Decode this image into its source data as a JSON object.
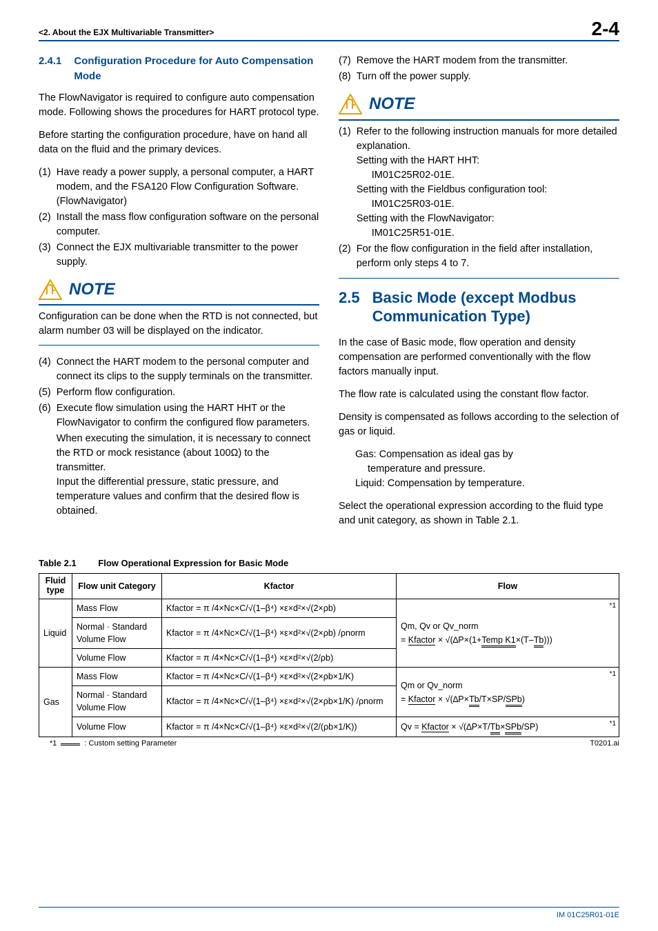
{
  "header": {
    "chapter": "<2.  About the EJX Multivariable Transmitter>",
    "page_number": "2-4"
  },
  "left": {
    "subheading_num": "2.4.1",
    "subheading_text": "Configuration Procedure for Auto Compensation Mode",
    "para1": "The FlowNavigator is required to configure auto compensation mode. Following shows the procedures for HART protocol type.",
    "para2": "Before starting the configuration procedure, have on hand all data on the fluid and the primary devices.",
    "steps_a": [
      {
        "n": "(1)",
        "t": "Have ready a power supply, a personal computer, a HART modem, and the FSA120 Flow Configuration Software. (FlowNavigator)"
      },
      {
        "n": "(2)",
        "t": "Install the mass flow configuration software on the personal computer."
      },
      {
        "n": "(3)",
        "t": "Connect the EJX multivariable transmitter to the power supply."
      }
    ],
    "note1_title": "NOTE",
    "note1_body": "Configuration can be done when the RTD is not connected, but alarm number 03 will be displayed on the indicator.",
    "steps_b": [
      {
        "n": "(4)",
        "t": "Connect the HART modem to the personal computer and connect its clips to the supply terminals on the transmitter."
      },
      {
        "n": "(5)",
        "t": "Perform flow configuration."
      },
      {
        "n": "(6)",
        "t": "Execute flow simulation using the HART HHT or the FlowNavigator to confirm the configured flow parameters.",
        "extra": "When executing the simulation, it is necessary to connect the RTD or mock resistance (about 100Ω) to the transmitter.\nInput the differential pressure, static pressure, and temperature values and confirm that the desired flow is obtained."
      }
    ]
  },
  "right": {
    "steps_c": [
      {
        "n": "(7)",
        "t": "Remove the HART modem from the transmitter."
      },
      {
        "n": "(8)",
        "t": "Turn off the power supply."
      }
    ],
    "note2_title": "NOTE",
    "note2_items": [
      {
        "n": "(1)",
        "lines": [
          "Refer to the following instruction manuals for more detailed explanation.",
          "Setting with the HART HHT:",
          "IM01C25R02-01E.",
          "Setting with the Fieldbus configuration tool:",
          "IM01C25R03-01E.",
          "Setting with the FlowNavigator:",
          "IM01C25R51-01E."
        ]
      },
      {
        "n": "(2)",
        "lines": [
          "For the flow configuration in the field after installation, perform only steps 4 to 7."
        ]
      }
    ],
    "sec_num": "2.5",
    "sec_text": "Basic Mode (except Modbus Communication Type)",
    "para1": "In the case of Basic mode, flow operation and density compensation are performed conventionally with the flow factors manually input.",
    "para2": "The flow rate is calculated using the constant flow factor.",
    "para3": "Density is compensated as follows according to the selection of gas or liquid.",
    "gas_line1": "Gas: Compensation as ideal gas by",
    "gas_line2": "temperature and pressure.",
    "liq_line": "Liquid: Compensation by temperature.",
    "para4": "Select the operational expression according to the fluid type and unit category, as shown in Table 2.1."
  },
  "table": {
    "caption_label": "Table 2.1",
    "caption_text": "Flow Operational Expression for Basic Mode",
    "head": {
      "c1a": "Fluid",
      "c1b": "type",
      "c2": "Flow unit Category",
      "c3": "Kfactor",
      "c4": "Flow"
    },
    "rows": [
      {
        "ft": "Liquid",
        "cat": "Mass Flow",
        "kf": "Kfactor = π /4×Nc×C/√(1–β⁴) ×ε×d²×√(2×ρb)"
      },
      {
        "cat": "Normal · Standard Volume Flow",
        "kf": "Kfactor = π /4×Nc×C/√(1–β⁴) ×ε×d²×√(2×ρb) /ρnorm"
      },
      {
        "cat": "Volume Flow",
        "kf": "Kfactor = π /4×Nc×C/√(1–β⁴) ×ε×d²×√(2/ρb)"
      },
      {
        "ft": "Gas",
        "cat": "Mass Flow",
        "kf": "Kfactor = π /4×Nc×C/√(1–β⁴) ×ε×d²×√(2×ρb×1/K)"
      },
      {
        "cat": "Normal · Standard Volume Flow",
        "kf": "Kfactor = π /4×Nc×C/√(1–β⁴) ×ε×d²×√(2×ρb×1/K) /ρnorm"
      },
      {
        "cat": "Volume Flow",
        "kf": "Kfactor = π /4×Nc×C/√(1–β⁴) ×ε×d²×√(2/(ρb×1/K))"
      }
    ],
    "flow_liquid_l1": "Qm, Qv or Qv_norm",
    "flow_liquid_l2a": "= ",
    "flow_liquid_kf": "Kfactor",
    "flow_liquid_mid": " × √(∆P×(1+",
    "flow_liquid_tk": "Temp K1",
    "flow_liquid_mid2": "×(T–",
    "flow_liquid_tb": "Tb",
    "flow_liquid_end": ")))",
    "flow_gas1_l1": "Qm or Qv_norm",
    "flow_gas1_l2a": "= ",
    "flow_gas1_kf": "Kfactor",
    "flow_gas1_mid": " × √(∆P×",
    "flow_gas1_tb": "Tb",
    "flow_gas1_mid2": "/T×SP/",
    "flow_gas1_spb": "SPb",
    "flow_gas1_end": ")",
    "flow_gas2_pre": "Qv = ",
    "flow_gas2_kf": "Kfactor",
    "flow_gas2_mid": " × √(∆P×T/",
    "flow_gas2_tb": "Tb",
    "flow_gas2_mid2": "×",
    "flow_gas2_spb": "SPb",
    "flow_gas2_end": "/SP)",
    "star": "*1",
    "footnote_label": "*1",
    "footnote_text": ": Custom setting Parameter",
    "fig_id": "T0201.ai"
  },
  "doc_id": "IM 01C25R01-01E"
}
